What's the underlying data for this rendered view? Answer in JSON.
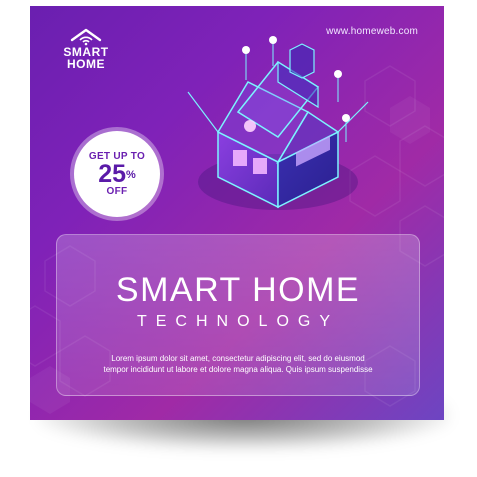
{
  "brand": {
    "logo_line1": "SMART",
    "logo_line2": "HOME"
  },
  "url": "www.homeweb.com",
  "badge": {
    "line1": "GET UP TO",
    "amount": "25",
    "symbol": "%",
    "line3": "OFF"
  },
  "headline": {
    "title": "SMART HOME",
    "subtitle": "TECHNOLOGY"
  },
  "body": {
    "line1": "Lorem ipsum dolor sit amet, consectetur adipiscing elit, sed do eiusmod",
    "line2": "tempor incididunt ut labore et dolore magna aliqua. Quis ipsum suspendisse"
  },
  "icons": [
    "house-logo-icon",
    "wifi-icon",
    "smart-house-illustration"
  ],
  "colors": {
    "background_start": "#6a1fb0",
    "background_end": "#a02aa6",
    "accent": "#5a1aa8",
    "text": "#ffffff"
  }
}
